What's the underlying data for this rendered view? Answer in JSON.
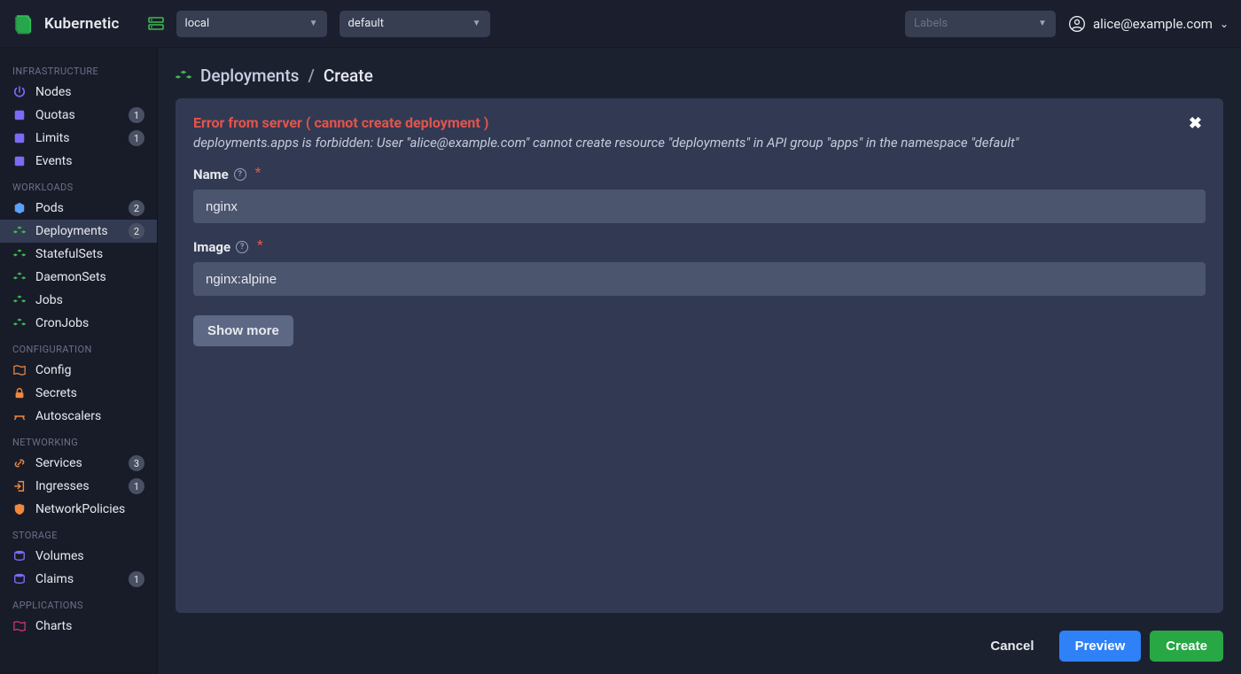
{
  "app": {
    "name": "Kubernetic"
  },
  "topbar": {
    "context": "local",
    "namespace": "default",
    "labels_placeholder": "Labels",
    "user": "alice@example.com"
  },
  "sidebar": {
    "sections": [
      {
        "title": "INFRASTRUCTURE",
        "items": [
          {
            "icon": "power",
            "color": "c-violet",
            "label": "Nodes",
            "count": null
          },
          {
            "icon": "quota",
            "color": "c-violet",
            "label": "Quotas",
            "count": 1
          },
          {
            "icon": "quota",
            "color": "c-violet",
            "label": "Limits",
            "count": 1
          },
          {
            "icon": "quota",
            "color": "c-violet",
            "label": "Events",
            "count": null
          }
        ]
      },
      {
        "title": "WORKLOADS",
        "items": [
          {
            "icon": "cube",
            "color": "c-blue",
            "label": "Pods",
            "count": 2
          },
          {
            "icon": "cubes",
            "color": "c-green",
            "label": "Deployments",
            "count": 2,
            "active": true
          },
          {
            "icon": "cubes",
            "color": "c-green",
            "label": "StatefulSets",
            "count": null
          },
          {
            "icon": "cubes",
            "color": "c-green",
            "label": "DaemonSets",
            "count": null
          },
          {
            "icon": "cubes",
            "color": "c-green",
            "label": "Jobs",
            "count": null
          },
          {
            "icon": "cubes",
            "color": "c-green",
            "label": "CronJobs",
            "count": null
          }
        ]
      },
      {
        "title": "CONFIGURATION",
        "items": [
          {
            "icon": "map",
            "color": "c-orange",
            "label": "Config",
            "count": null
          },
          {
            "icon": "lock",
            "color": "c-orange",
            "label": "Secrets",
            "count": null
          },
          {
            "icon": "scale",
            "color": "c-orange",
            "label": "Autoscalers",
            "count": null
          }
        ]
      },
      {
        "title": "NETWORKING",
        "items": [
          {
            "icon": "link",
            "color": "c-orange",
            "label": "Services",
            "count": 3
          },
          {
            "icon": "login",
            "color": "c-orange",
            "label": "Ingresses",
            "count": 1
          },
          {
            "icon": "shield",
            "color": "c-orange",
            "label": "NetworkPolicies",
            "count": null
          }
        ]
      },
      {
        "title": "STORAGE",
        "items": [
          {
            "icon": "db",
            "color": "c-violet",
            "label": "Volumes",
            "count": null
          },
          {
            "icon": "db",
            "color": "c-violet",
            "label": "Claims",
            "count": 1
          }
        ]
      },
      {
        "title": "APPLICATIONS",
        "items": [
          {
            "icon": "map",
            "color": "c-pink",
            "label": "Charts",
            "count": null
          }
        ]
      }
    ]
  },
  "breadcrumb": {
    "resource": "Deployments",
    "page": "Create"
  },
  "error": {
    "title": "Error from server ( cannot create deployment )",
    "message": "deployments.apps is forbidden: User \"alice@example.com\" cannot create resource \"deployments\" in API group \"apps\" in the namespace \"default\""
  },
  "form": {
    "name_label": "Name",
    "name_value": "nginx",
    "image_label": "Image",
    "image_value": "nginx:alpine",
    "show_more": "Show more"
  },
  "actions": {
    "cancel": "Cancel",
    "preview": "Preview",
    "create": "Create"
  }
}
